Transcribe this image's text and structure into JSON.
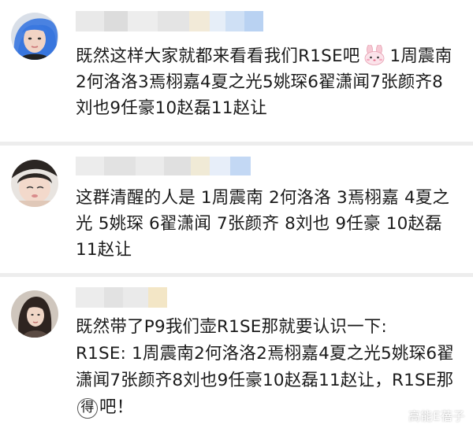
{
  "comments": [
    {
      "text_before_emoji": "既然这样大家就都来看看我们R1SE吧",
      "emoji": "bunny-emoji",
      "text_after_emoji": "1周震南2何洛洛3焉栩嘉4夏之光5姚琛6翟潇闻7张颜齐8刘也9任豪10赵磊11赵让"
    },
    {
      "text": "这群清醒的人是 1周震南 2何洛洛 3焉栩嘉 4夏之光 5姚琛 6翟潇闻 7张颜齐 8刘也 9任豪 10赵磊 11赵让"
    },
    {
      "text_line1": "既然带了P9我们壶R1SE那就要认识一下:",
      "text_line2": "R1SE: 1周震南2何洛洛2焉栩嘉4夏之光5姚琛6翟潇闻7张颜齐8刘也9任豪10赵磊11赵让，R1SE那",
      "boxed_char": "得",
      "text_end": "吧！"
    }
  ],
  "watermark": "高能E蓓子",
  "colors": {
    "divider": "#ededed",
    "text": "#1a1a1a",
    "watermark": "#ffffff"
  }
}
